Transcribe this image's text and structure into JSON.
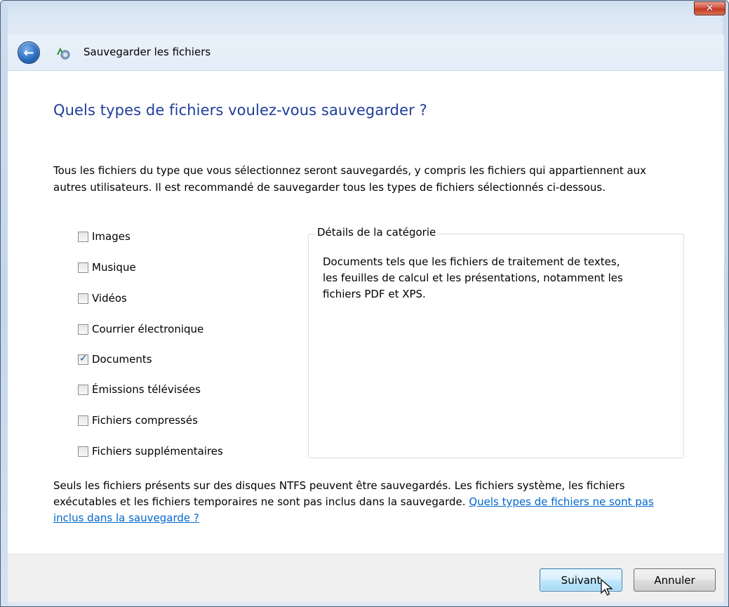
{
  "window": {
    "close_label": "✕",
    "title": "Sauvegarder les fichiers"
  },
  "main": {
    "heading": "Quels types de fichiers voulez-vous sauvegarder ?",
    "intro": "Tous les fichiers du type que vous sélectionnez seront sauvegardés, y compris les fichiers qui appartiennent aux autres utilisateurs. Il est recommandé de sauvegarder tous les types de fichiers sélectionnés ci-dessous.",
    "categories": [
      {
        "label": "Images",
        "checked": false
      },
      {
        "label": "Musique",
        "checked": false
      },
      {
        "label": "Vidéos",
        "checked": false
      },
      {
        "label": "Courrier électronique",
        "checked": false
      },
      {
        "label": "Documents",
        "checked": true
      },
      {
        "label": "Émissions télévisées",
        "checked": false
      },
      {
        "label": "Fichiers compressés",
        "checked": false
      },
      {
        "label": "Fichiers supplémentaires",
        "checked": false
      }
    ],
    "details": {
      "legend": "Détails de la catégorie",
      "text": "Documents tels que les fichiers de traitement de textes, les feuilles de calcul et les présentations, notamment les fichiers PDF et XPS."
    },
    "footer_note": "Seuls les fichiers présents sur des disques NTFS peuvent être sauvegardés. Les fichiers système, les fichiers exécutables et les fichiers temporaires ne sont pas inclus dans la sauvegarde. ",
    "footer_link": "Quels types de fichiers ne sont pas inclus dans la sauvegarde ?"
  },
  "buttons": {
    "next": "Suivant",
    "cancel": "Annuler"
  },
  "colors": {
    "heading": "#1e3d99",
    "link": "#0066cc",
    "close": "#c23a20"
  }
}
